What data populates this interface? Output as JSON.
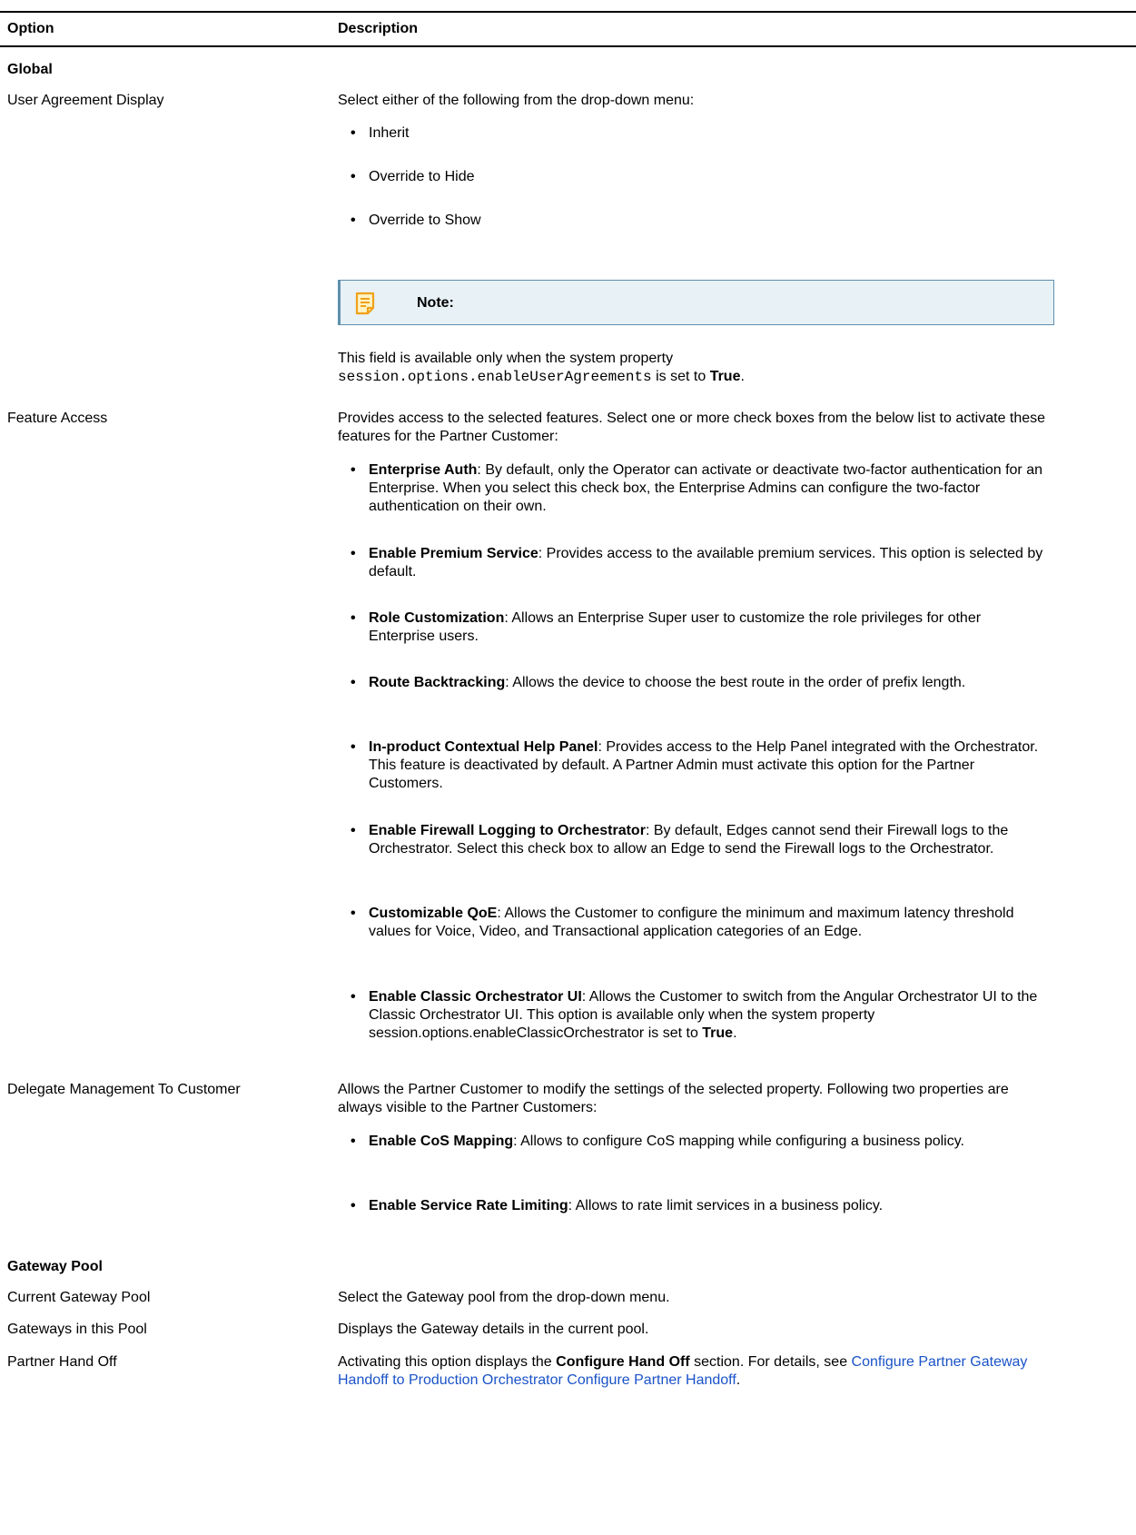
{
  "table": {
    "headers": {
      "option": "Option",
      "description": "Description"
    },
    "sections": {
      "global": "Global",
      "gateway_pool": "Gateway Pool"
    }
  },
  "rows": {
    "user_agreement": {
      "option": "User Agreement Display",
      "intro": "Select either of the following from the drop-down menu:",
      "bullets": [
        "Inherit",
        "Override to Hide",
        "Override to Show"
      ],
      "note_label": "Note:",
      "after_note_1": "This field is available only when the system property",
      "code": "session.options.enableUserAgreements",
      "after_code": " is set to ",
      "true_word": "True",
      "period": "."
    },
    "feature_access": {
      "option": "Feature Access",
      "intro": "Provides access to the selected features. Select one or more check boxes from the below list to activate these features for the Partner Customer:",
      "bullets": [
        {
          "term": "Enterprise Auth",
          "text": ": By default, only the Operator can activate or deactivate two-factor authentication for an Enterprise. When you select this check box, the Enterprise Admins can configure the two-factor authentication on their own."
        },
        {
          "term": "Enable Premium Service",
          "text": ": Provides access to the available premium services. This option is selected by default."
        },
        {
          "term": "Role Customization",
          "text": ": Allows an Enterprise Super user to customize the role privileges for other Enterprise users."
        },
        {
          "term": "Route Backtracking",
          "text": ": Allows the device to choose the best route in the order of prefix length."
        },
        {
          "term": "In-product Contextual Help Panel",
          "text": ": Provides access to the Help Panel integrated with the Orchestrator. This feature is deactivated by default. A Partner Admin must activate this option for the Partner Customers."
        },
        {
          "term": "Enable Firewall Logging to Orchestrator",
          "text": ": By default, Edges cannot send their Firewall logs to the Orchestrator. Select this check box to allow an Edge to send the Firewall logs to the Orchestrator."
        },
        {
          "term": "Customizable QoE",
          "text": ": Allows the Customer to configure the minimum and maximum latency threshold values for Voice, Video, and Transactional application categories of an Edge."
        },
        {
          "term": "Enable Classic Orchestrator UI",
          "text": ": Allows the Customer to switch from the Angular Orchestrator UI to the Classic Orchestrator UI. This option is available only when the system property session.options.enableClassicOrchestrator is set to ",
          "tail_bold": "True",
          "tail": "."
        }
      ]
    },
    "delegate": {
      "option": "Delegate Management To Customer",
      "intro": "Allows the Partner Customer to modify the settings of the selected property. Following two properties are always visible to the Partner Customers:",
      "bullets": [
        {
          "term": "Enable CoS Mapping",
          "text": ": Allows to configure CoS mapping while configuring a business policy."
        },
        {
          "term": "Enable Service Rate Limiting",
          "text": ": Allows to rate limit services in a business policy."
        }
      ]
    },
    "current_pool": {
      "option": "Current Gateway Pool",
      "desc": "Select the Gateway pool from the drop-down menu."
    },
    "gateways_in_pool": {
      "option": "Gateways in this Pool",
      "desc": "Displays the Gateway details in the current pool."
    },
    "partner_handoff": {
      "option": "Partner Hand Off",
      "desc_1": "Activating this option displays the ",
      "desc_bold": "Configure Hand Off",
      "desc_2": " section. For details, see ",
      "link_1": "Configure Partner Gateway Handoff to Production Orchestrator",
      "space": " ",
      "link_2": "Configure Partner Handoff",
      "period": "."
    }
  },
  "colors": {
    "note_bg": "#e8f1f5",
    "note_border": "#5f8fad",
    "link": "#1a53c8",
    "note_icon": "#f0a11a"
  }
}
